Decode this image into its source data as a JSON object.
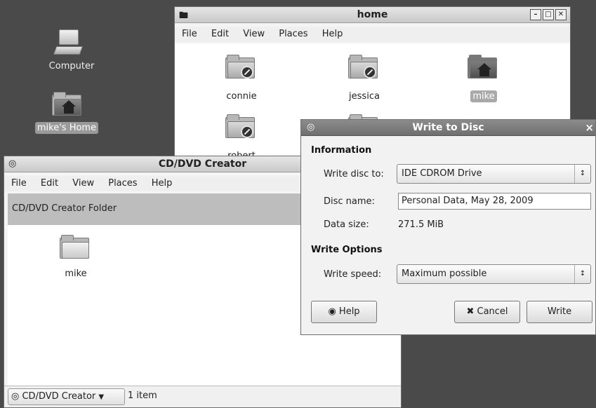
{
  "desktop": {
    "computer_label": "Computer",
    "home_label": "mike's Home"
  },
  "home_window": {
    "title": "home",
    "menu": [
      "File",
      "Edit",
      "View",
      "Places",
      "Help"
    ],
    "folders": [
      "connie",
      "jessica",
      "mike",
      "robert"
    ]
  },
  "cd_window": {
    "title": "CD/DVD Creator",
    "menu": [
      "File",
      "Edit",
      "View",
      "Places",
      "Help"
    ],
    "location_bar": "CD/DVD Creator Folder",
    "folder": "mike",
    "status_location": "CD/DVD Creator",
    "status_count": "1 item"
  },
  "dialog": {
    "title": "Write to Disc",
    "information_header": "Information",
    "write_disc_to_label": "Write disc to:",
    "write_disc_to_value": "IDE CDROM Drive",
    "disc_name_label": "Disc name:",
    "disc_name_value": "Personal Data, May 28, 2009",
    "data_size_label": "Data size:",
    "data_size_value": "271.5 MiB",
    "write_options_header": "Write Options",
    "write_speed_label": "Write speed:",
    "write_speed_value": "Maximum possible",
    "help_button": "Help",
    "cancel_button": "Cancel",
    "write_button": "Write",
    "close_glyph": "×"
  }
}
